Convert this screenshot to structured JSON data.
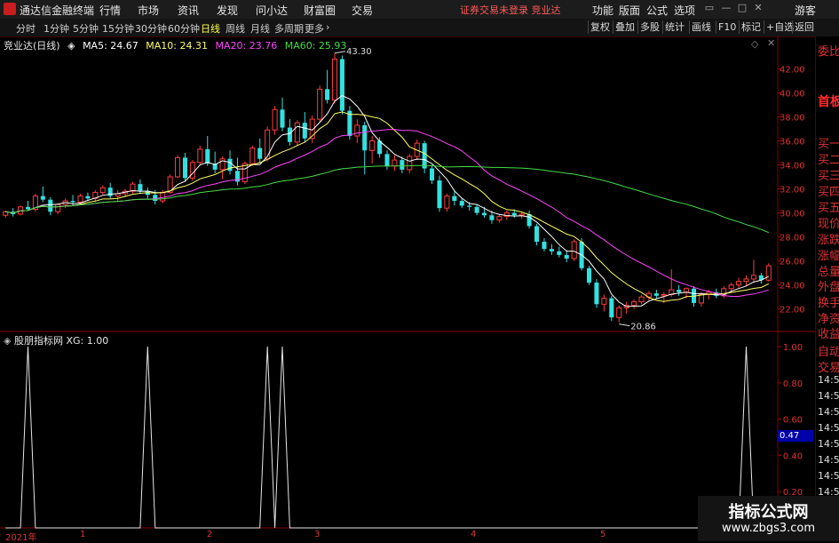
{
  "app": {
    "title": "通达信金融终端",
    "menu": [
      "行情",
      "市场",
      "资讯",
      "发现",
      "问小达",
      "财富圈",
      "交易"
    ],
    "status": "证券交易未登录  竞业达",
    "right_menu": [
      "功能",
      "版面",
      "公式",
      "选项"
    ],
    "user": "游客"
  },
  "toolbar": {
    "periods": [
      "分时",
      "1分钟",
      "5分钟",
      "15分钟",
      "30分钟",
      "60分钟",
      "日线",
      "周线",
      "月线",
      "多周期",
      "更多"
    ],
    "active_period": "日线",
    "right_buttons": [
      "复权",
      "叠加",
      "多股",
      "统计",
      "画线",
      "F10",
      "标记",
      "+自选",
      "返回"
    ]
  },
  "legend": {
    "name": "竞业达(日线)",
    "ma": [
      {
        "label": "MA5: 24.67",
        "color": "#ffffff"
      },
      {
        "label": "MA10: 24.31",
        "color": "#ffff66"
      },
      {
        "label": "MA20: 23.76",
        "color": "#ff44ff"
      },
      {
        "label": "MA60: 25.93",
        "color": "#44dd44"
      }
    ]
  },
  "indicator": {
    "name": "股朋指标网",
    "value": "XG: 1.00",
    "current": "0.47"
  },
  "side_panel": [
    "委比",
    "首板",
    "买一",
    "买二",
    "买三",
    "买四",
    "买五",
    "现价",
    "涨跌",
    "涨幅",
    "总量",
    "外盘",
    "换手",
    "净资",
    "收益",
    "自动",
    "交易",
    "14:55",
    "14:56",
    "14:56",
    "14:56",
    "14:56",
    "14:56",
    "14:56",
    "14:56"
  ],
  "x_labels": [
    "2021年",
    "1",
    "2",
    "3",
    "4",
    "5"
  ],
  "watermark": {
    "line1": "指标公式网",
    "line2": "www.zbgs3.com"
  },
  "chart_data": {
    "type": "candlestick",
    "price_axis": {
      "min": 20.5,
      "max": 43.8,
      "ticks": [
        22.0,
        24.0,
        26.0,
        28.0,
        30.0,
        32.0,
        34.0,
        36.0,
        38.0,
        40.0,
        42.0
      ]
    },
    "annotations": [
      {
        "text": "43.30",
        "kind": "high"
      },
      {
        "text": "20.86",
        "kind": "low"
      }
    ],
    "candles": [
      [
        29.8,
        30.2,
        29.6,
        30.1
      ],
      [
        30.1,
        30.4,
        29.7,
        29.9
      ],
      [
        29.9,
        30.6,
        29.8,
        30.5
      ],
      [
        30.5,
        31.0,
        30.2,
        30.3
      ],
      [
        30.3,
        31.6,
        30.1,
        31.4
      ],
      [
        31.4,
        32.2,
        30.9,
        31.1
      ],
      [
        31.1,
        31.3,
        29.8,
        30.1
      ],
      [
        30.1,
        30.8,
        29.9,
        30.7
      ],
      [
        30.7,
        31.2,
        30.4,
        31.0
      ],
      [
        31.0,
        31.5,
        30.6,
        30.9
      ],
      [
        30.9,
        31.6,
        30.7,
        31.4
      ],
      [
        31.4,
        31.7,
        31.0,
        31.2
      ],
      [
        31.2,
        31.9,
        30.9,
        31.7
      ],
      [
        31.7,
        32.3,
        31.5,
        32.1
      ],
      [
        32.1,
        32.5,
        31.2,
        31.4
      ],
      [
        31.4,
        31.9,
        30.9,
        31.6
      ],
      [
        31.6,
        32.0,
        31.3,
        31.8
      ],
      [
        31.8,
        32.6,
        31.6,
        32.4
      ],
      [
        32.4,
        32.8,
        31.6,
        31.8
      ],
      [
        31.8,
        32.1,
        31.2,
        31.5
      ],
      [
        31.5,
        31.9,
        30.7,
        31.0
      ],
      [
        31.0,
        31.9,
        30.8,
        31.7
      ],
      [
        31.7,
        33.2,
        31.6,
        33.0
      ],
      [
        33.0,
        34.8,
        32.9,
        34.6
      ],
      [
        34.6,
        35.0,
        32.6,
        32.9
      ],
      [
        32.9,
        34.4,
        32.7,
        34.2
      ],
      [
        34.2,
        35.6,
        34.0,
        35.3
      ],
      [
        35.3,
        36.4,
        33.9,
        34.1
      ],
      [
        34.1,
        35.1,
        33.3,
        33.6
      ],
      [
        33.6,
        34.7,
        32.8,
        34.5
      ],
      [
        34.5,
        35.2,
        33.2,
        33.5
      ],
      [
        33.5,
        34.6,
        32.3,
        32.6
      ],
      [
        32.6,
        34.3,
        32.4,
        34.1
      ],
      [
        34.1,
        35.6,
        33.9,
        35.4
      ],
      [
        35.4,
        36.2,
        34.2,
        34.5
      ],
      [
        34.5,
        37.2,
        34.3,
        36.9
      ],
      [
        36.9,
        38.9,
        36.5,
        38.6
      ],
      [
        38.6,
        39.6,
        36.8,
        37.1
      ],
      [
        37.1,
        37.8,
        35.6,
        35.9
      ],
      [
        35.9,
        37.7,
        35.6,
        37.5
      ],
      [
        37.5,
        38.4,
        35.9,
        36.2
      ],
      [
        36.2,
        38.1,
        35.8,
        37.8
      ],
      [
        37.8,
        40.6,
        37.6,
        40.3
      ],
      [
        40.3,
        41.9,
        39.1,
        39.4
      ],
      [
        39.4,
        43.3,
        39.1,
        42.8
      ],
      [
        42.8,
        43.1,
        38.2,
        38.5
      ],
      [
        38.5,
        38.9,
        36.1,
        36.4
      ],
      [
        36.4,
        37.8,
        35.8,
        37.3
      ],
      [
        37.3,
        37.6,
        33.2,
        35.2
      ],
      [
        35.2,
        36.4,
        34.1,
        36.0
      ],
      [
        36.0,
        36.3,
        34.6,
        34.9
      ],
      [
        34.9,
        35.2,
        33.6,
        33.9
      ],
      [
        33.9,
        34.8,
        33.5,
        34.4
      ],
      [
        34.4,
        34.7,
        33.3,
        33.6
      ],
      [
        33.6,
        34.9,
        33.3,
        34.7
      ],
      [
        34.7,
        36.1,
        34.4,
        35.8
      ],
      [
        35.8,
        36.0,
        33.3,
        33.7
      ],
      [
        33.7,
        34.0,
        32.4,
        32.7
      ],
      [
        32.7,
        33.1,
        30.1,
        30.4
      ],
      [
        30.4,
        31.6,
        30.1,
        31.4
      ],
      [
        31.4,
        31.8,
        30.6,
        31.0
      ],
      [
        31.0,
        31.2,
        30.4,
        30.6
      ],
      [
        30.6,
        30.9,
        30.2,
        30.5
      ],
      [
        30.5,
        30.7,
        29.8,
        30.0
      ],
      [
        30.0,
        30.5,
        29.6,
        29.8
      ],
      [
        29.8,
        30.2,
        29.1,
        29.4
      ],
      [
        29.4,
        29.9,
        29.2,
        29.7
      ],
      [
        29.7,
        30.2,
        29.4,
        30.0
      ],
      [
        30.0,
        30.3,
        29.6,
        29.8
      ],
      [
        29.8,
        30.1,
        29.5,
        29.9
      ],
      [
        29.9,
        30.2,
        28.7,
        28.9
      ],
      [
        28.9,
        29.1,
        27.3,
        27.6
      ],
      [
        27.6,
        27.9,
        26.8,
        27.0
      ],
      [
        27.0,
        27.4,
        26.5,
        26.8
      ],
      [
        26.8,
        27.2,
        26.3,
        26.5
      ],
      [
        26.5,
        26.9,
        25.9,
        26.2
      ],
      [
        26.2,
        27.8,
        26.0,
        27.6
      ],
      [
        27.6,
        27.9,
        25.2,
        25.4
      ],
      [
        25.4,
        25.6,
        24.0,
        24.2
      ],
      [
        24.2,
        24.5,
        22.1,
        22.4
      ],
      [
        22.4,
        23.2,
        21.8,
        22.9
      ],
      [
        22.9,
        23.1,
        21.0,
        21.3
      ],
      [
        21.3,
        22.3,
        20.9,
        22.1
      ],
      [
        22.1,
        22.6,
        21.6,
        22.3
      ],
      [
        22.3,
        22.8,
        22.0,
        22.6
      ],
      [
        22.6,
        23.2,
        22.4,
        23.0
      ],
      [
        23.0,
        23.5,
        22.7,
        23.3
      ],
      [
        23.3,
        23.6,
        22.9,
        23.1
      ],
      [
        23.1,
        23.4,
        22.5,
        23.2
      ],
      [
        23.2,
        25.3,
        23.0,
        23.6
      ],
      [
        23.6,
        24.0,
        23.1,
        23.4
      ],
      [
        23.4,
        23.8,
        22.9,
        23.7
      ],
      [
        23.7,
        23.9,
        22.2,
        22.5
      ],
      [
        22.5,
        23.4,
        22.2,
        23.2
      ],
      [
        23.2,
        23.6,
        22.8,
        23.4
      ],
      [
        23.4,
        23.7,
        22.9,
        23.1
      ],
      [
        23.1,
        23.9,
        22.9,
        23.7
      ],
      [
        23.7,
        24.2,
        23.4,
        24.0
      ],
      [
        24.0,
        24.6,
        23.7,
        24.3
      ],
      [
        24.3,
        24.8,
        23.9,
        24.5
      ],
      [
        24.5,
        26.1,
        24.2,
        24.8
      ],
      [
        24.8,
        25.0,
        24.1,
        24.4
      ],
      [
        24.4,
        25.8,
        24.3,
        25.6
      ]
    ],
    "moving_averages": [
      {
        "label": "MA5",
        "color": "#ffffff",
        "period": 5
      },
      {
        "label": "MA10",
        "color": "#ffff66",
        "period": 10
      },
      {
        "label": "MA20",
        "color": "#ff44ff",
        "period": 20
      },
      {
        "label": "MA60",
        "color": "#44dd44",
        "period": 60
      }
    ],
    "indicator_series": {
      "name": "XG",
      "y_ticks": [
        0.2,
        0.4,
        0.6,
        0.8,
        1.0
      ],
      "signal_bars": [
        3,
        19,
        35,
        37,
        99,
        105
      ]
    }
  }
}
